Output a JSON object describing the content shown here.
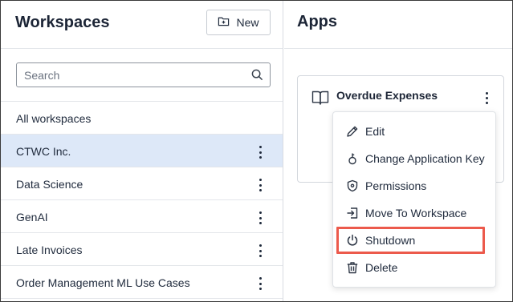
{
  "left_panel": {
    "title": "Workspaces",
    "new_button_label": "New",
    "search_placeholder": "Search",
    "search_value": "",
    "workspaces": [
      {
        "label": "All workspaces",
        "selected": false,
        "has_menu": false
      },
      {
        "label": "CTWC Inc.",
        "selected": true,
        "has_menu": true
      },
      {
        "label": "Data Science",
        "selected": false,
        "has_menu": true
      },
      {
        "label": "GenAI",
        "selected": false,
        "has_menu": true
      },
      {
        "label": "Late Invoices",
        "selected": false,
        "has_menu": true
      },
      {
        "label": "Order Management ML Use Cases",
        "selected": false,
        "has_menu": true
      }
    ]
  },
  "right_panel": {
    "title": "Apps",
    "app_card": {
      "name": "Overdue Expenses",
      "icon": "book-icon"
    },
    "context_menu": {
      "items": [
        {
          "label": "Edit",
          "icon": "pencil-icon"
        },
        {
          "label": "Change Application Key",
          "icon": "key-icon"
        },
        {
          "label": "Permissions",
          "icon": "shield-icon"
        },
        {
          "label": "Move To Workspace",
          "icon": "move-icon"
        },
        {
          "label": "Shutdown",
          "icon": "power-icon"
        },
        {
          "label": "Delete",
          "icon": "trash-icon"
        }
      ],
      "highlighted_item": "Shutdown"
    }
  },
  "colors": {
    "selected_row": "#dde8f8",
    "highlight_border": "#ec5a4c",
    "text": "#1f2a3c"
  }
}
